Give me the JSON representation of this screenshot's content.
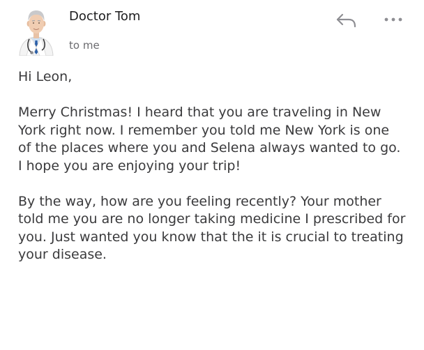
{
  "email": {
    "sender_name": "Doctor Tom",
    "recipient_line": "to me",
    "greeting": "Hi Leon,",
    "paragraphs": [
      "Merry Christmas! I heard that you are traveling in New York right now. I remember you told me New York is one of the places where you and Selena always wanted to go. I hope you are enjoying your trip!",
      "By the way, how are you feeling recently? Your mother told me you are no longer taking medicine I prescribed for you. Just wanted you know that the it is crucial to treating your disease."
    ]
  },
  "icons": {
    "avatar": "doctor-avatar",
    "reply": "reply-arrow-icon",
    "more": "more-horizontal-icon"
  },
  "colors": {
    "text": "#3a3a3c",
    "sender": "#1c1c1e",
    "secondary": "#6b6b6f",
    "icon": "#8e8e93",
    "background": "#ffffff"
  }
}
